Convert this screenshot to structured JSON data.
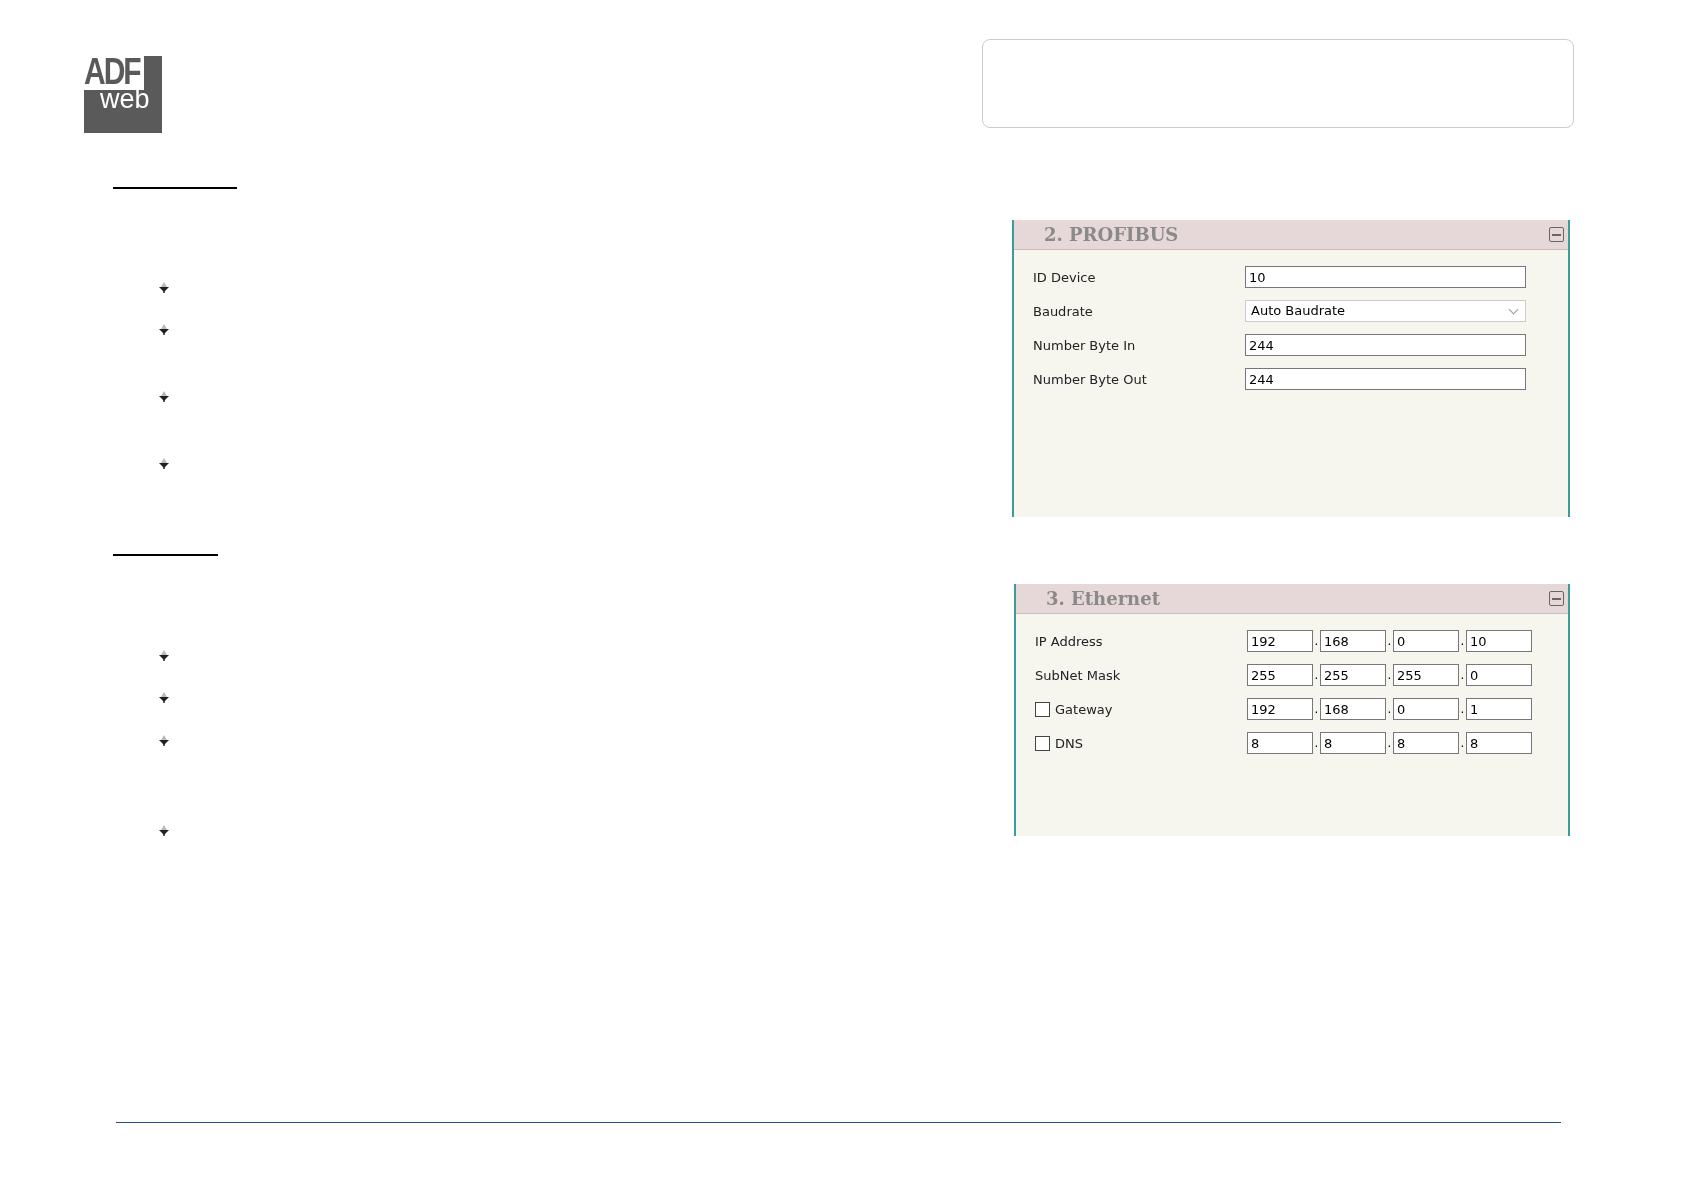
{
  "logo": {
    "line_1": "ADF",
    "line_2": "web"
  },
  "panels": [
    {
      "title": "2. PROFIBUS",
      "rows": [
        {
          "kind": "text",
          "label": "ID Device",
          "value": "10"
        },
        {
          "kind": "select",
          "label": "Baudrate",
          "value": "Auto Baudrate"
        },
        {
          "kind": "text",
          "label": "Number Byte In",
          "value": "244"
        },
        {
          "kind": "text",
          "label": "Number Byte Out",
          "value": "244"
        }
      ]
    },
    {
      "title": "3. Ethernet",
      "rows": [
        {
          "kind": "ip",
          "label": "IP Address",
          "octets": [
            "192",
            "168",
            "0",
            "10"
          ],
          "separator": "."
        },
        {
          "kind": "ip",
          "label": "SubNet Mask",
          "octets": [
            "255",
            "255",
            "255",
            "0"
          ],
          "separator": "."
        },
        {
          "kind": "check_ip",
          "label": "Gateway",
          "checked": false,
          "octets": [
            "192",
            "168",
            "0",
            "1"
          ],
          "separator": "."
        },
        {
          "kind": "check_ip",
          "label": "DNS",
          "checked": false,
          "octets": [
            "8",
            "8",
            "8",
            "8"
          ],
          "separator": "."
        }
      ]
    }
  ]
}
